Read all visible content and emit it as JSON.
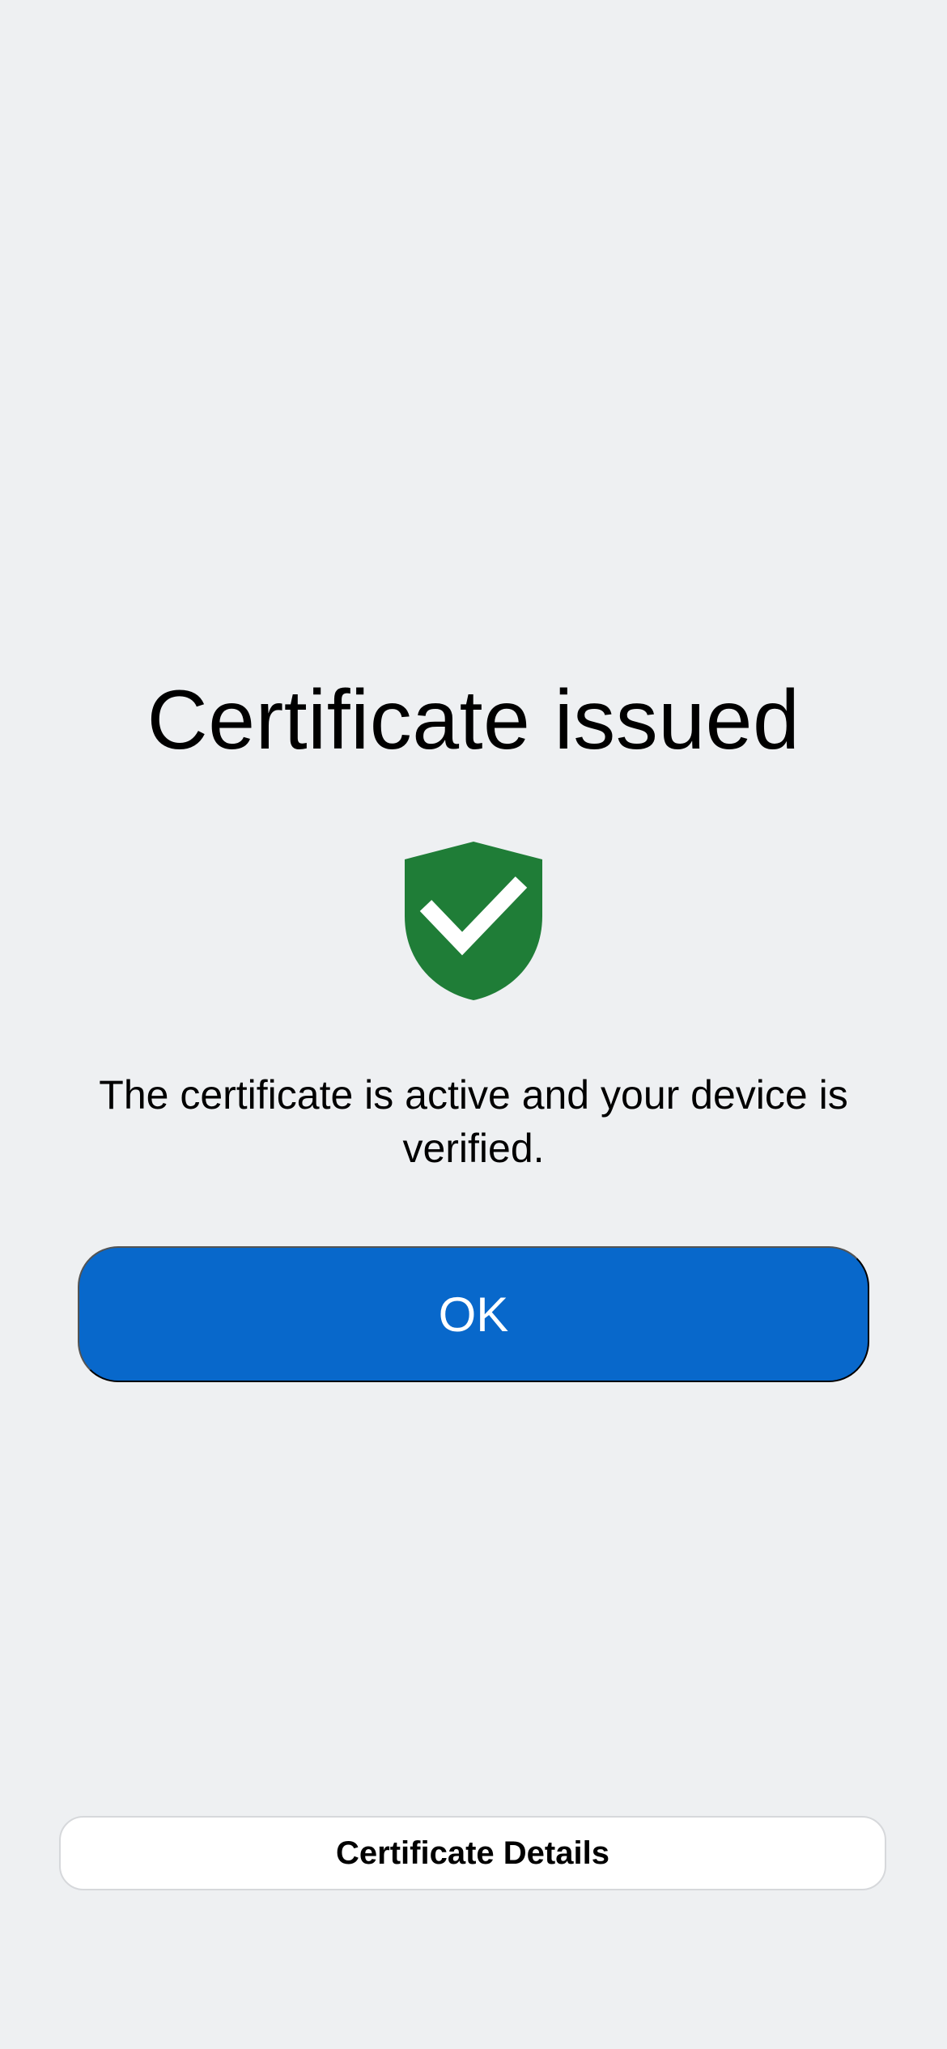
{
  "screen": {
    "title": "Certificate issued",
    "message": "The certificate is active and your device is verified.",
    "status_icon": "shield-check-icon"
  },
  "actions": {
    "ok_label": "OK",
    "details_label": "Certificate Details"
  },
  "colors": {
    "background": "#eef0f2",
    "shield": "#1f7d37",
    "primary_button": "#0868cb",
    "secondary_button": "#ffffff"
  }
}
